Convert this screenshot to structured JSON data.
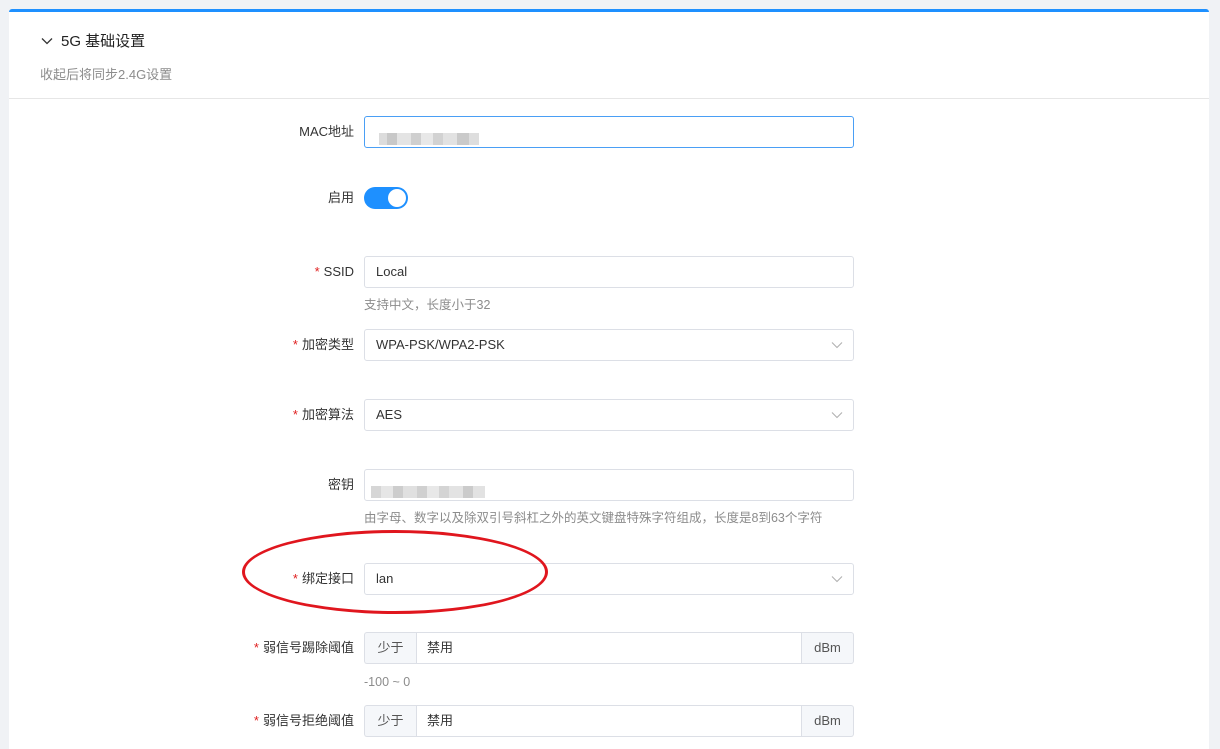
{
  "section": {
    "title": "5G 基础设置",
    "subtitle": "收起后将同步2.4G设置"
  },
  "fields": {
    "mac": {
      "label": "MAC地址"
    },
    "enable": {
      "label": "启用",
      "on": true
    },
    "ssid": {
      "label": "SSID",
      "value": "Local",
      "hint": "支持中文，长度小于32"
    },
    "enc_type": {
      "label": "加密类型",
      "value": "WPA-PSK/WPA2-PSK"
    },
    "enc_algo": {
      "label": "加密算法",
      "value": "AES"
    },
    "key": {
      "label": "密钥",
      "hint": "由字母、数字以及除双引号斜杠之外的英文键盘特殊字符组成，长度是8到63个字符"
    },
    "bind_iface": {
      "label": "绑定接口",
      "value": "lan"
    },
    "weak_kick": {
      "label": "弱信号踢除阈值",
      "prefix": "少于",
      "value": "禁用",
      "suffix": "dBm",
      "hint": "-100 ~ 0"
    },
    "weak_reject": {
      "label": "弱信号拒绝阈值",
      "prefix": "少于",
      "value": "禁用",
      "suffix": "dBm"
    }
  },
  "colors": {
    "accent": "#1e90ff",
    "required": "#e02020",
    "annotation": "#e0161e"
  }
}
